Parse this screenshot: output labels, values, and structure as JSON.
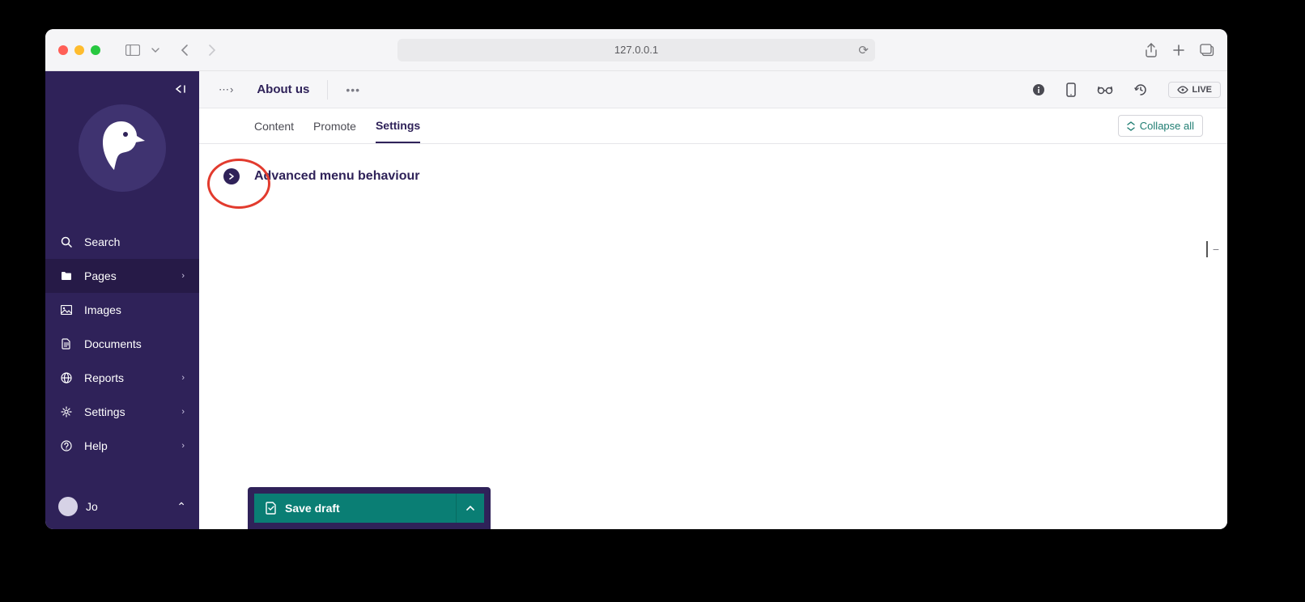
{
  "browser": {
    "address": "127.0.0.1"
  },
  "sidebar": {
    "items": [
      {
        "label": "Search"
      },
      {
        "label": "Pages"
      },
      {
        "label": "Images"
      },
      {
        "label": "Documents"
      },
      {
        "label": "Reports"
      },
      {
        "label": "Settings"
      },
      {
        "label": "Help"
      }
    ],
    "user": "Jo"
  },
  "header": {
    "page_title": "About us",
    "live_label": "LIVE"
  },
  "tabs": [
    {
      "label": "Content"
    },
    {
      "label": "Promote"
    },
    {
      "label": "Settings"
    }
  ],
  "collapse_all_label": "Collapse all",
  "panel": {
    "title": "Advanced menu behaviour"
  },
  "minimap_symbol": "−",
  "save": {
    "label": "Save draft"
  }
}
